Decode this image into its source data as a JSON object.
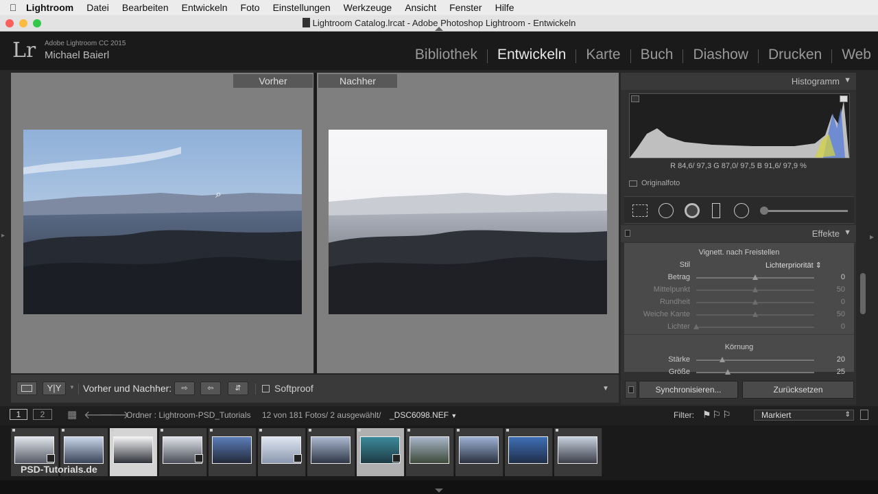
{
  "menubar": {
    "items": [
      "Lightroom",
      "Datei",
      "Bearbeiten",
      "Entwickeln",
      "Foto",
      "Einstellungen",
      "Werkzeuge",
      "Ansicht",
      "Fenster",
      "Hilfe"
    ]
  },
  "window": {
    "title": "Lightroom Catalog.lrcat - Adobe Photoshop Lightroom - Entwickeln"
  },
  "identity": {
    "logo": "Lr",
    "product": "Adobe Lightroom CC 2015",
    "user": "Michael Baierl"
  },
  "modules": [
    {
      "label": "Bibliothek",
      "active": false
    },
    {
      "label": "Entwickeln",
      "active": true
    },
    {
      "label": "Karte",
      "active": false
    },
    {
      "label": "Buch",
      "active": false
    },
    {
      "label": "Diashow",
      "active": false
    },
    {
      "label": "Drucken",
      "active": false
    },
    {
      "label": "Web",
      "active": false
    }
  ],
  "compare": {
    "before_label": "Vorher",
    "after_label": "Nachher"
  },
  "toolbar": {
    "yy_label": "Y|Y",
    "before_after_label": "Vorher und Nachher:",
    "softproof_label": "Softproof"
  },
  "histogram": {
    "title": "Histogramm",
    "readout": "R 84,6/ 97,3  G 87,0/ 97,5  B 91,6/ 97,9 %",
    "original_label": "Originalfoto"
  },
  "effects": {
    "title": "Effekte",
    "vignette_title": "Vignett. nach Freistellen",
    "style_label": "Stil",
    "style_value": "Lichterpriorität",
    "sliders": [
      {
        "label": "Betrag",
        "value": "0",
        "fraction": 0.5,
        "dim": false
      },
      {
        "label": "Mittelpunkt",
        "value": "50",
        "fraction": 0.5,
        "dim": true
      },
      {
        "label": "Rundheit",
        "value": "0",
        "fraction": 0.5,
        "dim": true
      },
      {
        "label": "Weiche Kante",
        "value": "50",
        "fraction": 0.5,
        "dim": true
      },
      {
        "label": "Lichter",
        "value": "0",
        "fraction": 0.0,
        "dim": true
      }
    ],
    "grain_title": "Körnung",
    "grain_sliders": [
      {
        "label": "Stärke",
        "value": "20",
        "fraction": 0.22
      },
      {
        "label": "Größe",
        "value": "25",
        "fraction": 0.27
      }
    ]
  },
  "panel_buttons": {
    "sync": "Synchronisieren...",
    "reset": "Zurücksetzen"
  },
  "filmstrip_bar": {
    "page1": "1",
    "page2": "2",
    "folder_text": "Ordner : Lightroom-PSD_Tutorials",
    "count_text": "12 von 181 Fotos/ 2 ausgewählt/",
    "filename": "_DSC6098.NEF",
    "filter_label": "Filter:",
    "filter_value": "Markiert"
  },
  "watermark": "PSD-Tutorials.de",
  "colors": {
    "accent_active": "#e8e8e8",
    "pane_bg": "#7f7f7f",
    "panel_bg": "#303030"
  }
}
